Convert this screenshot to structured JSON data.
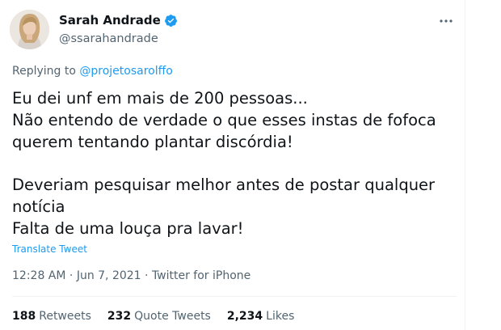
{
  "tweet": {
    "author": {
      "display_name": "Sarah Andrade",
      "handle": "@ssarahandrade",
      "verified": true,
      "avatar_icon": "profile-photo"
    },
    "more_icon": "more-horizontal-icon",
    "reply": {
      "prefix": "Replying to",
      "mention": "@projetosarolffo"
    },
    "body_lines": [
      "Eu dei unf em mais de 200 pessoas...",
      "Não entendo de verdade o que esses instas de fofoca",
      "querem tentando plantar discórdia!",
      "Deveriam pesquisar melhor antes de postar qualquer",
      "notícia",
      "Falta de uma louça pra lavar!"
    ],
    "translate_label": "Translate Tweet",
    "meta": {
      "time": "12:28 AM",
      "date": "Jun 7, 2021",
      "source": "Twitter for iPhone",
      "separator": "·"
    },
    "stats": {
      "retweets_count": "188",
      "retweets_label": "Retweets",
      "quotes_count": "232",
      "quotes_label": "Quote Tweets",
      "likes_count": "2,234",
      "likes_label": "Likes"
    },
    "colors": {
      "link": "#1d9bf0",
      "secondary_text": "#536471",
      "primary_text": "#0f1419",
      "verified_badge": "#1d9bf0"
    }
  }
}
